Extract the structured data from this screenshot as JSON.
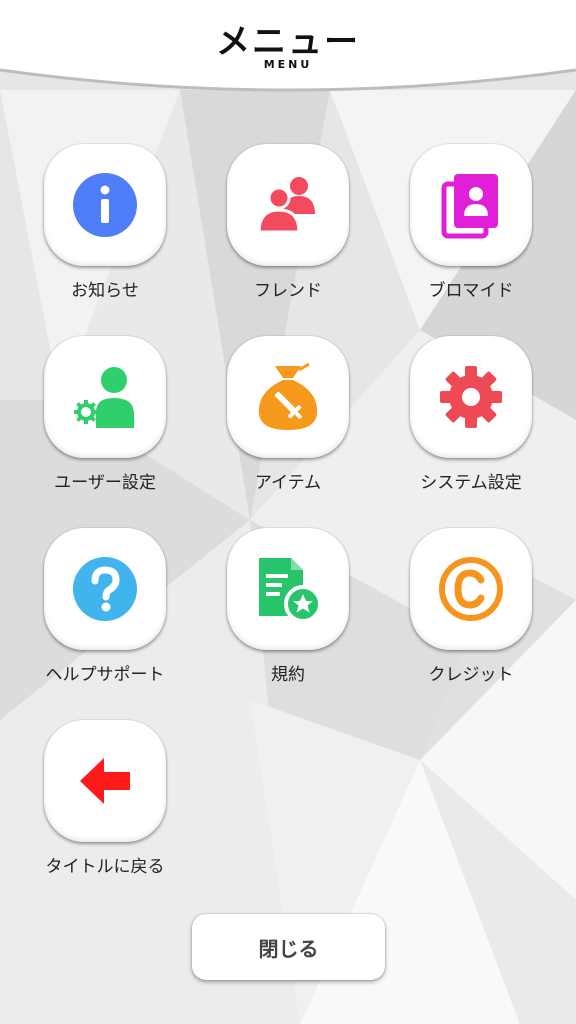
{
  "header": {
    "title": "メニュー",
    "subtitle": "MENU"
  },
  "menu": {
    "items": [
      {
        "label": "お知らせ",
        "icon": "info-icon",
        "color": "#4f7cf7"
      },
      {
        "label": "フレンド",
        "icon": "friends-icon",
        "color": "#f24b5e"
      },
      {
        "label": "ブロマイド",
        "icon": "bromide-icon",
        "color": "#e21fd8"
      },
      {
        "label": "ユーザー設定",
        "icon": "user-settings-icon",
        "color": "#2fcf6c"
      },
      {
        "label": "アイテム",
        "icon": "item-bag-icon",
        "color": "#f59a1c"
      },
      {
        "label": "システム設定",
        "icon": "gear-icon",
        "color": "#ee4a55"
      },
      {
        "label": "ヘルプサポート",
        "icon": "help-icon",
        "color": "#41b4ee"
      },
      {
        "label": "規約",
        "icon": "terms-document-icon",
        "color": "#27c46b"
      },
      {
        "label": "クレジット",
        "icon": "copyright-icon",
        "color": "#f7941d"
      },
      {
        "label": "タイトルに戻る",
        "icon": "back-arrow-icon",
        "color": "#ff1a1a"
      }
    ]
  },
  "footer": {
    "close_label": "閉じる"
  }
}
